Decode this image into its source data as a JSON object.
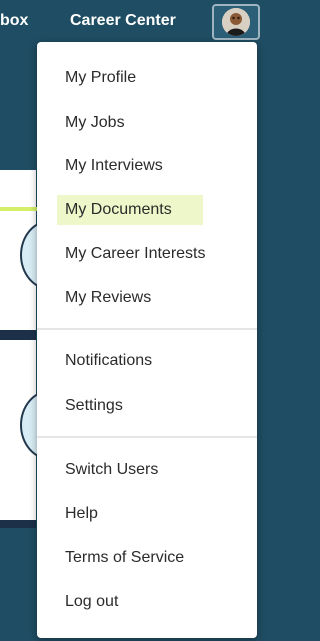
{
  "topbar": {
    "inbox_label": "box",
    "career_center_label": "Career Center",
    "avatar_icon": "user-avatar-icon"
  },
  "menu": {
    "group1": [
      {
        "label": "My Profile"
      },
      {
        "label": "My Jobs"
      },
      {
        "label": "My Interviews"
      },
      {
        "label": "My Documents"
      },
      {
        "label": "My Career Interests"
      },
      {
        "label": "My Reviews"
      }
    ],
    "group2": [
      {
        "label": "Notifications"
      },
      {
        "label": "Settings"
      }
    ],
    "group3": [
      {
        "label": "Switch Users"
      },
      {
        "label": "Help"
      },
      {
        "label": "Terms of Service"
      },
      {
        "label": "Log out"
      }
    ],
    "highlighted_item": "My Documents",
    "highlight_color": "#eef7c9",
    "pointer_color": "#d4f06a"
  },
  "colors": {
    "header_bg": "#1f4d63",
    "menu_bg": "#ffffff",
    "text": "#2b2b2b"
  }
}
